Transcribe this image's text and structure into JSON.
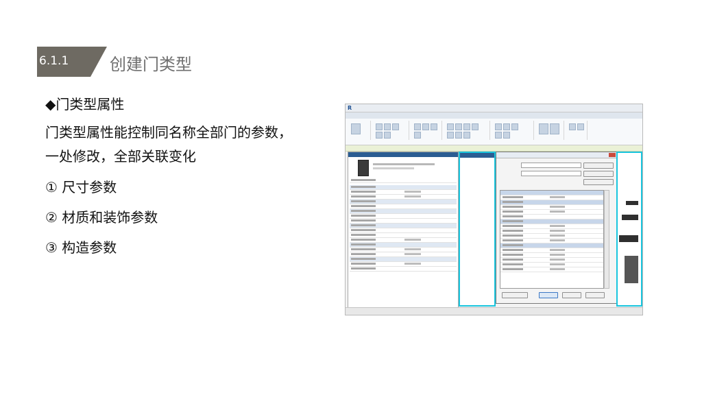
{
  "section": {
    "number": "6.1.1",
    "title": "创建门类型"
  },
  "content": {
    "subheading": "◆门类型属性",
    "paragraph": "门类型属性能控制同名称全部门的参数，一处修改，全部关联变化",
    "items": [
      "① 尺寸参数",
      "② 材质和装饰参数",
      "③ 构造参数"
    ]
  },
  "colors": {
    "section_tag": "#6e6a62",
    "highlight_border": "#18c5de"
  }
}
